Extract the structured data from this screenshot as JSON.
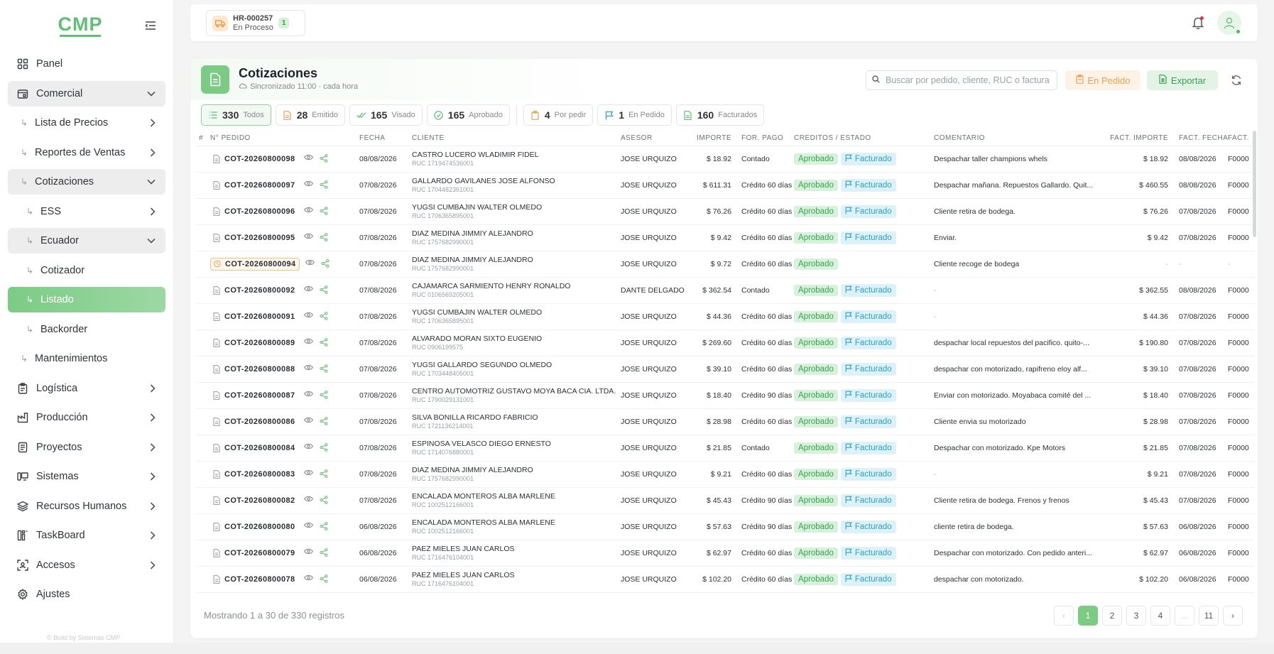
{
  "logo": {
    "text": "CMP"
  },
  "sidebar": {
    "items": [
      {
        "label": "Panel"
      },
      {
        "label": "Comercial"
      },
      {
        "label": "Lista de Precios"
      },
      {
        "label": "Reportes de Ventas"
      },
      {
        "label": "Cotizaciones"
      },
      {
        "label": "ESS"
      },
      {
        "label": "Ecuador"
      },
      {
        "label": "Cotizador"
      },
      {
        "label": "Listado"
      },
      {
        "label": "Backorder"
      },
      {
        "label": "Mantenimientos"
      },
      {
        "label": "Logística"
      },
      {
        "label": "Producción"
      },
      {
        "label": "Proyectos"
      },
      {
        "label": "Sistemas"
      },
      {
        "label": "Recursos Humanos"
      },
      {
        "label": "TaskBoard"
      },
      {
        "label": "Accesos"
      },
      {
        "label": "Ajustes"
      }
    ],
    "footer": "© Build by Sistemas CMP"
  },
  "topbar": {
    "order_id": "HR-000257",
    "order_state": "En Proceso",
    "order_count": "1"
  },
  "page": {
    "title": "Cotizaciones",
    "sync": "Sincronizado 11:00 · cada hora",
    "search_placeholder": "Buscar por pedido, cliente, RUC o factura",
    "btn_pedido": "En Pedido",
    "btn_export": "Exportar"
  },
  "filters": [
    {
      "count": "330",
      "label": "Todos"
    },
    {
      "count": "28",
      "label": "Emitido"
    },
    {
      "count": "165",
      "label": "Visado"
    },
    {
      "count": "165",
      "label": "Aprobado"
    },
    {
      "count": "4",
      "label": "Por pedir"
    },
    {
      "count": "1",
      "label": "En Pedido"
    },
    {
      "count": "160",
      "label": "Facturados"
    }
  ],
  "columns": {
    "hash": "#",
    "pedido": "N° PEDIDO",
    "fecha": "FECHA",
    "cliente": "CLIENTE",
    "asesor": "ASESOR",
    "importe": "IMPORTE",
    "pago": "FOR. PAGO",
    "estado": "CRÉDITOS / ESTADO",
    "comentario": "COMENTARIO",
    "fimporte": "FACT. IMPORTE",
    "ffecha": "FACT. FECHA",
    "fact": "FACT."
  },
  "badges": {
    "approved": "Aprobado",
    "invoiced": "Facturado"
  },
  "rows": [
    {
      "id": "COT-20260800098",
      "fecha": "08/08/2026",
      "cliente": "CASTRO LUCERO WLADIMIR FIDEL",
      "ruc": "RUC 1719474536001",
      "asesor": "JOSE URQUIZO",
      "importe": "$ 18.92",
      "pago": "Contado",
      "comentario": "Despachar taller champions whels",
      "fimporte": "$ 18.92",
      "ffecha": "08/08/2026",
      "fact": "F0000"
    },
    {
      "id": "COT-20260800097",
      "fecha": "07/08/2026",
      "cliente": "GALLARDO GAVILANES JOSE ALFONSO",
      "ruc": "RUC 1704482361001",
      "asesor": "JOSE URQUIZO",
      "importe": "$ 611.31",
      "pago": "Crédito 60 días",
      "comentario": "Despachar mañana. Repuestos Gallardo. Quit...",
      "fimporte": "$ 460.55",
      "ffecha": "08/08/2026",
      "fact": "F0000"
    },
    {
      "id": "COT-20260800096",
      "fecha": "07/08/2026",
      "cliente": "YUGSI CUMBAJIN WALTER OLMEDO",
      "ruc": "RUC 1706365895001",
      "asesor": "JOSE URQUIZO",
      "importe": "$ 76.26",
      "pago": "Crédito 60 días",
      "comentario": "Cliente retira de bodega.",
      "fimporte": "$ 76.26",
      "ffecha": "07/08/2026",
      "fact": "F0000"
    },
    {
      "id": "COT-20260800095",
      "fecha": "07/08/2026",
      "cliente": "DIAZ MEDINA JIMMIY ALEJANDRO",
      "ruc": "RUC 1757682990001",
      "asesor": "JOSE URQUIZO",
      "importe": "$ 9.42",
      "pago": "Crédito 60 días",
      "comentario": "Enviar.",
      "fimporte": "$ 9.42",
      "ffecha": "07/08/2026",
      "fact": "F0000"
    },
    {
      "id": "COT-20260800094",
      "fecha": "07/08/2026",
      "cliente": "DIAZ MEDINA JIMMIY ALEJANDRO",
      "ruc": "RUC 1757682990001",
      "asesor": "JOSE URQUIZO",
      "importe": "$ 9.72",
      "pago": "Crédito 60 días",
      "comentario": "Cliente recoge de bodega",
      "fimporte": "-",
      "ffecha": "-",
      "fact": "-",
      "warn": true,
      "nofac": true
    },
    {
      "id": "COT-20260800092",
      "fecha": "07/08/2026",
      "cliente": "CAJAMARCA SARMIENTO HENRY RONALDO",
      "ruc": "RUC 0106569205001",
      "asesor": "DANTE DELGADO",
      "importe": "$ 362.54",
      "pago": "Contado",
      "comentario": "-",
      "fimporte": "$ 362.55",
      "ffecha": "08/08/2026",
      "fact": "F0000"
    },
    {
      "id": "COT-20260800091",
      "fecha": "07/08/2026",
      "cliente": "YUGSI CUMBAJIN WALTER OLMEDO",
      "ruc": "RUC 1706365895001",
      "asesor": "JOSE URQUIZO",
      "importe": "$ 44.36",
      "pago": "Crédito 60 días",
      "comentario": "-",
      "fimporte": "$ 44.36",
      "ffecha": "07/08/2026",
      "fact": "F0000"
    },
    {
      "id": "COT-20260800089",
      "fecha": "07/08/2026",
      "cliente": "ALVARADO MORAN SIXTO EUGENIO",
      "ruc": "RUC 0906199575",
      "asesor": "JOSE URQUIZO",
      "importe": "$ 269.60",
      "pago": "Crédito 60 días",
      "comentario": "despachar local repuestos del pacifico. quito-...",
      "fimporte": "$ 190.80",
      "ffecha": "07/08/2026",
      "fact": "F0000"
    },
    {
      "id": "COT-20260800088",
      "fecha": "07/08/2026",
      "cliente": "YUGSI GALLARDO SEGUNDO OLMEDO",
      "ruc": "RUC 1703448405001",
      "asesor": "JOSE URQUIZO",
      "importe": "$ 39.10",
      "pago": "Crédito 60 días",
      "comentario": "despachar con motorizado, rapifreno eloy alf...",
      "fimporte": "$ 39.10",
      "ffecha": "07/08/2026",
      "fact": "F0000"
    },
    {
      "id": "COT-20260800087",
      "fecha": "07/08/2026",
      "cliente": "CENTRO AUTOMOTRIZ GUSTAVO MOYA BACA CIA. LTDA.",
      "ruc": "RUC 1790029131001",
      "asesor": "JOSE URQUIZO",
      "importe": "$ 18.40",
      "pago": "Crédito 90 días",
      "comentario": "Enviar con motorizado. Moyabaca comité del ...",
      "fimporte": "$ 18.40",
      "ffecha": "07/08/2026",
      "fact": "F0000"
    },
    {
      "id": "COT-20260800086",
      "fecha": "07/08/2026",
      "cliente": "SILVA BONILLA RICARDO FABRICIO",
      "ruc": "RUC 1721136214001",
      "asesor": "JOSE URQUIZO",
      "importe": "$ 28.98",
      "pago": "Crédito 60 días",
      "comentario": "Cliente envia su motorizado",
      "fimporte": "$ 28.98",
      "ffecha": "07/08/2026",
      "fact": "F0000"
    },
    {
      "id": "COT-20260800084",
      "fecha": "07/08/2026",
      "cliente": "ESPINOSA VELASCO DIEGO ERNESTO",
      "ruc": "RUC 1714076880001",
      "asesor": "JOSE URQUIZO",
      "importe": "$ 21.85",
      "pago": "Contado",
      "comentario": "Despachar con motorizado. Kpe Motors",
      "fimporte": "$ 21.85",
      "ffecha": "07/08/2026",
      "fact": "F0000"
    },
    {
      "id": "COT-20260800083",
      "fecha": "07/08/2026",
      "cliente": "DIAZ MEDINA JIMMIY ALEJANDRO",
      "ruc": "RUC 1757682990001",
      "asesor": "JOSE URQUIZO",
      "importe": "$ 9.21",
      "pago": "Crédito 60 días",
      "comentario": "-",
      "fimporte": "$ 9.21",
      "ffecha": "07/08/2026",
      "fact": "F0000"
    },
    {
      "id": "COT-20260800082",
      "fecha": "07/08/2026",
      "cliente": "ENCALADA MONTEROS ALBA MARLENE",
      "ruc": "RUC 1002512166001",
      "asesor": "JOSE URQUIZO",
      "importe": "$ 45.43",
      "pago": "Crédito 90 días",
      "comentario": "Cliente retira de bodega. Frenos y frenos",
      "fimporte": "$ 45.43",
      "ffecha": "07/08/2026",
      "fact": "F0000"
    },
    {
      "id": "COT-20260800080",
      "fecha": "06/08/2026",
      "cliente": "ENCALADA MONTEROS ALBA MARLENE",
      "ruc": "RUC 1002512166001",
      "asesor": "JOSE URQUIZO",
      "importe": "$ 57.63",
      "pago": "Crédito 90 días",
      "comentario": "cliente retira de bodega.",
      "fimporte": "$ 57.63",
      "ffecha": "06/08/2026",
      "fact": "F0000"
    },
    {
      "id": "COT-20260800079",
      "fecha": "06/08/2026",
      "cliente": "PAEZ MIELES JUAN CARLOS",
      "ruc": "RUC 1716476104001",
      "asesor": "JOSE URQUIZO",
      "importe": "$ 62.97",
      "pago": "Crédito 60 días",
      "comentario": "Despachar con motorizado. Con pedido anteri...",
      "fimporte": "$ 62.97",
      "ffecha": "06/08/2026",
      "fact": "F0000"
    },
    {
      "id": "COT-20260800078",
      "fecha": "06/08/2026",
      "cliente": "PAEZ MIELES JUAN CARLOS",
      "ruc": "RUC 1716476104001",
      "asesor": "JOSE URQUIZO",
      "importe": "$ 102.20",
      "pago": "Crédito 60 días",
      "comentario": "despachar con motorizado.",
      "fimporte": "$ 102.20",
      "ffecha": "06/08/2026",
      "fact": "F0000"
    }
  ],
  "footer": {
    "showing": "Mostrando 1 a 30 de 330 registros"
  },
  "pager": {
    "pages": [
      "1",
      "2",
      "3",
      "4",
      "...",
      "11"
    ],
    "current": "1",
    "prev": "‹",
    "next": "›"
  }
}
